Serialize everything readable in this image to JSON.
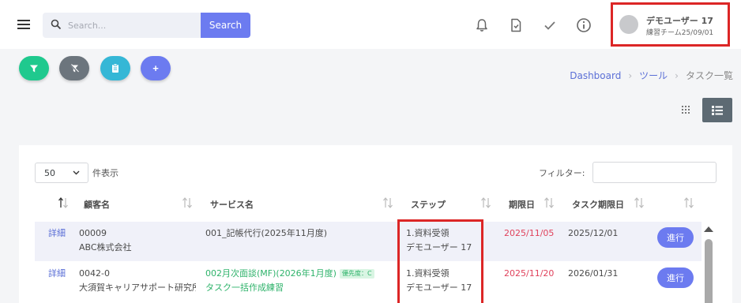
{
  "header": {
    "search_placeholder": "Search...",
    "search_button": "Search",
    "icons": [
      "bell-icon",
      "document-icon",
      "check-icon",
      "info-icon"
    ],
    "user": {
      "name": "デモユーザー 17",
      "team": "練習チーム25/09/01"
    }
  },
  "actions": [
    {
      "name": "filter-button",
      "icon": "filter-icon",
      "color": "#1fc98e"
    },
    {
      "name": "clear-filter-button",
      "icon": "filter-clear-icon",
      "color": "#6c757d"
    },
    {
      "name": "copy-button",
      "icon": "clipboard-icon",
      "color": "#35b7d6"
    },
    {
      "name": "add-button",
      "label": "+",
      "color": "#6c7bf0"
    }
  ],
  "breadcrumb": [
    "Dashboard",
    "ツール",
    "タスク一覧"
  ],
  "table_controls": {
    "page_length": "50",
    "length_suffix": "件表示",
    "filter_label": "フィルター:"
  },
  "columns": [
    "",
    "顧客名",
    "サービス名",
    "ステップ",
    "期限日",
    "タスク期限日",
    ""
  ],
  "rows": [
    {
      "detail": "詳細",
      "client_code": "00009",
      "client_name": "ABC株式会社",
      "service": "001_記帳代行(2025年11月度)",
      "step": "1.資料受領",
      "step_user": "デモユーザー 17",
      "due": "2025/11/05",
      "task_due": "2025/12/01",
      "action": "進行"
    },
    {
      "detail": "詳細",
      "client_code": "0042-0",
      "client_name": "大須賀キャリアサポート研究所",
      "service": "002月次面談(MF)(2026年1月度)",
      "priority": "優先度：C",
      "service_sub": "タスク一括作成練習",
      "step": "1.資料受領",
      "step_user": "デモユーザー 17",
      "due": "2025/11/20",
      "task_due": "2026/01/31",
      "action": "進行"
    }
  ],
  "colors": {
    "accent": "#6c7bf0",
    "link": "#5b6fd6",
    "overdue": "#e0425c",
    "highlight": "#dc2626"
  }
}
